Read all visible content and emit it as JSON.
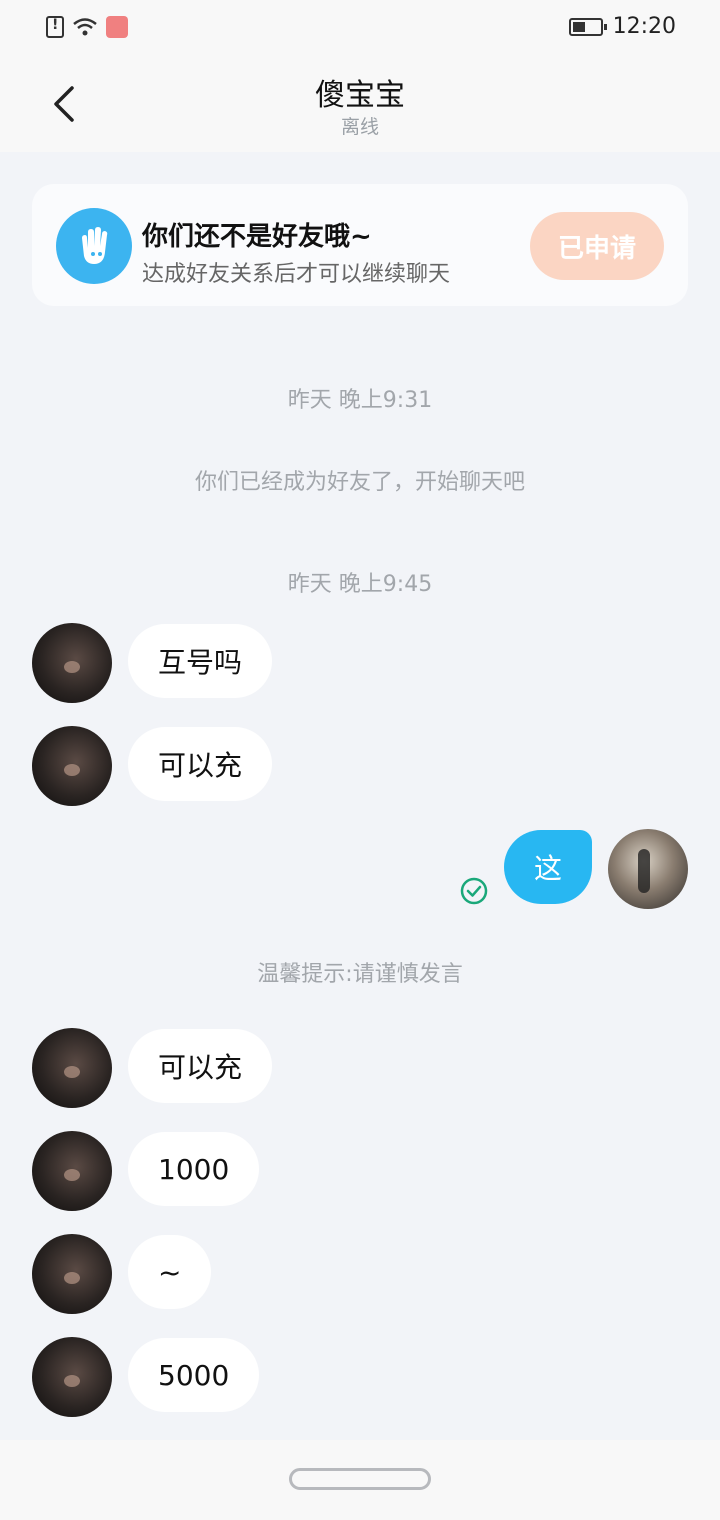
{
  "status_bar": {
    "time": "12:20"
  },
  "header": {
    "title": "傻宝宝",
    "status": "离线"
  },
  "friend_card": {
    "title": "你们还不是好友哦~",
    "subtitle": "达成好友关系后才可以继续聊天",
    "button_label": "已申请",
    "accent_color": "#3cb4f0"
  },
  "timeline": [
    {
      "type": "time",
      "text": "昨天 晚上9:31"
    },
    {
      "type": "notice",
      "text": "你们已经成为好友了，开始聊天吧"
    },
    {
      "type": "time",
      "text": "昨天 晚上9:45"
    },
    {
      "type": "msg",
      "from": "them",
      "text": "互号吗"
    },
    {
      "type": "msg",
      "from": "them",
      "text": "可以充"
    },
    {
      "type": "msg",
      "from": "me",
      "text": "这"
    },
    {
      "type": "notice",
      "text": "温馨提示:请谨慎发言"
    },
    {
      "type": "msg",
      "from": "them",
      "text": "可以充"
    },
    {
      "type": "msg",
      "from": "them",
      "text": "1000"
    },
    {
      "type": "msg",
      "from": "them",
      "text": "~"
    },
    {
      "type": "msg",
      "from": "them",
      "text": "5000"
    }
  ],
  "colors": {
    "bubble_me": "#28b7f2",
    "button_applied": "#fbd5c3",
    "check": "#1aa87a"
  }
}
